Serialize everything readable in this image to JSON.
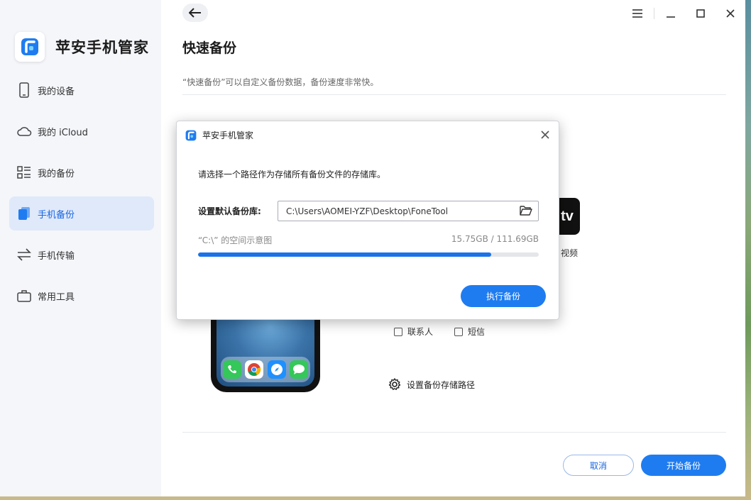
{
  "app": {
    "name": "苹安手机管家"
  },
  "sidebar": {
    "items": [
      {
        "label": "我的设备",
        "icon": "phone-icon"
      },
      {
        "label": "我的 iCloud",
        "icon": "cloud-icon"
      },
      {
        "label": "我的备份",
        "icon": "list-icon"
      },
      {
        "label": "手机备份",
        "icon": "backup-icon",
        "active": true
      },
      {
        "label": "手机传输",
        "icon": "transfer-icon"
      },
      {
        "label": "常用工具",
        "icon": "toolbox-icon"
      }
    ]
  },
  "main": {
    "title": "快速备份",
    "description": "“快速备份”可以自定义备份数据，备份速度非常快。",
    "video_label": "视频",
    "tv_text": "tv",
    "checkboxes": [
      {
        "label": "联系人",
        "checked": false
      },
      {
        "label": "短信",
        "checked": false
      }
    ],
    "set_path_label": "设置备份存储路径",
    "cancel_label": "取消",
    "start_label": "开始备份"
  },
  "modal": {
    "title": "苹安手机管家",
    "prompt": "请选择一个路径作为存储所有备份文件的存储库。",
    "path_label": "设置默认备份库:",
    "path_value": "C:\\Users\\AOMEI-YZF\\Desktop\\FoneTool",
    "space_label": "“C:\\” 的空间示意图",
    "space_value": "15.75GB / 111.69GB",
    "space_fraction": 0.86,
    "execute_label": "执行备份"
  },
  "colors": {
    "accent": "#1f7cf0",
    "sidebar_active_bg": "#dfe9fa"
  }
}
